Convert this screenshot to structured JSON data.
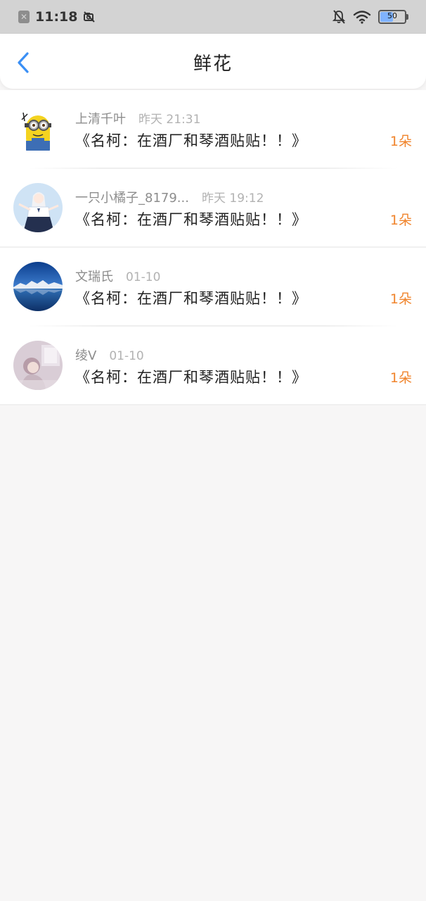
{
  "status_bar": {
    "time": "11:18",
    "battery": "50"
  },
  "header": {
    "title": "鲜花"
  },
  "items": [
    {
      "name": "上清千叶",
      "time": "昨天 21:31",
      "title": "《名柯：在酒厂和琴酒贴贴！！》",
      "count": "1朵",
      "avatar": "minion-avatar"
    },
    {
      "name": "一只小橘子_8179...",
      "time": "昨天 19:12",
      "title": "《名柯：在酒厂和琴酒贴贴！！》",
      "count": "1朵",
      "avatar": "anime-girl-avatar"
    },
    {
      "name": "文瑞氏",
      "time": "01-10",
      "title": "《名柯：在酒厂和琴酒贴贴！！》",
      "count": "1朵",
      "avatar": "mountain-lake-avatar"
    },
    {
      "name": "绫V",
      "time": "01-10",
      "title": "《名柯：在酒厂和琴酒贴贴！！》",
      "count": "1朵",
      "avatar": "pastel-girl-avatar"
    }
  ],
  "colors": {
    "accent_blue": "#3a8ff5",
    "count_orange": "#f0842c",
    "status_bar_bg": "#d3d3d3",
    "page_bg": "#f7f6f6"
  }
}
